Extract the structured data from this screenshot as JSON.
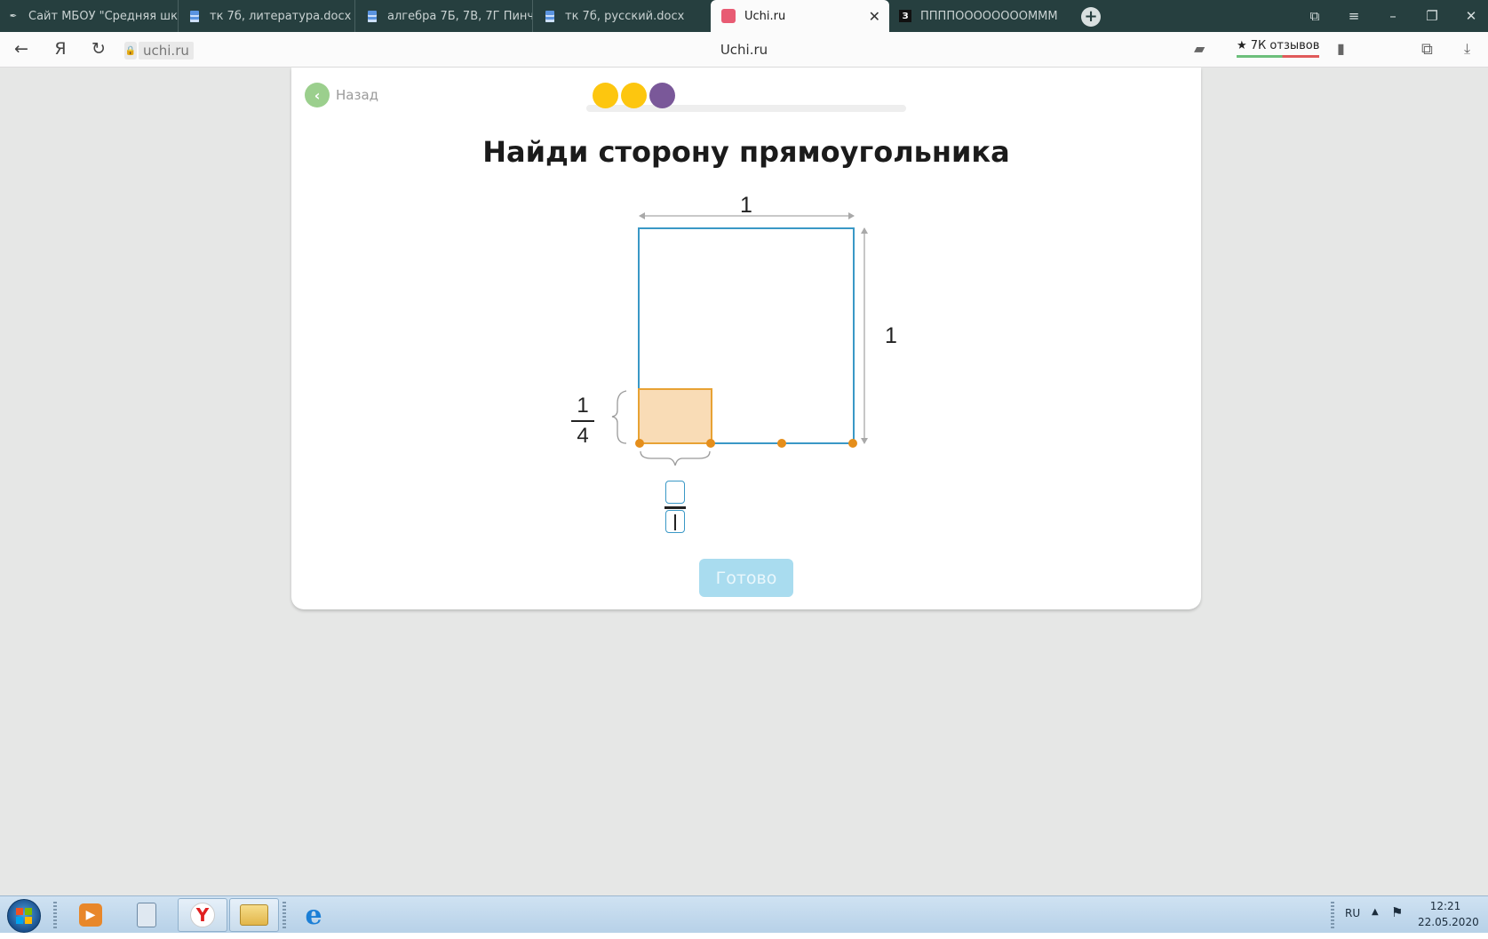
{
  "browser": {
    "tabs": [
      {
        "title": "Сайт МБОУ \"Средняя шко",
        "icon": "site-icon"
      },
      {
        "title": "тк 7б, литература.docx",
        "icon": "doc-icon"
      },
      {
        "title": "алгебра 7Б, 7В, 7Г Пинчук",
        "icon": "doc-icon"
      },
      {
        "title": "тк 7б, русский.docx",
        "icon": "doc-icon"
      },
      {
        "title": "Uchi.ru",
        "icon": "uchi-icon",
        "active": true,
        "close": "✕"
      },
      {
        "title": "ППППООООООООММММ",
        "icon": "z-icon",
        "badge": "З"
      }
    ],
    "new_tab": "+",
    "controls": {
      "bookmarks": "⧉",
      "menu": "≡",
      "minimize": "–",
      "restore": "❐",
      "close": "✕"
    },
    "nav": {
      "back": "←",
      "yandex": "Я",
      "reload": "↻"
    },
    "url": "uchi.ru",
    "page_title": "Uchi.ru",
    "reviews": "★ 7К отзывов"
  },
  "lesson": {
    "back_label": "Назад",
    "progress_dots": [
      "#fdc60f",
      "#fdc60f",
      "#7a5899"
    ],
    "title": "Найди сторону прямоугольника",
    "top_side_label": "1",
    "right_side_label": "1",
    "height_fraction": {
      "numerator": "1",
      "denominator": "4"
    },
    "answer": {
      "numerator": "",
      "denominator": ""
    },
    "done_button": "Готово",
    "colors": {
      "square": "#3a98c6",
      "rectangle_fill": "#f9dcb6",
      "rectangle_stroke": "#e8a234",
      "point": "#e58e1b"
    }
  },
  "taskbar": {
    "language": "RU",
    "time": "12:21",
    "date": "22.05.2020"
  }
}
